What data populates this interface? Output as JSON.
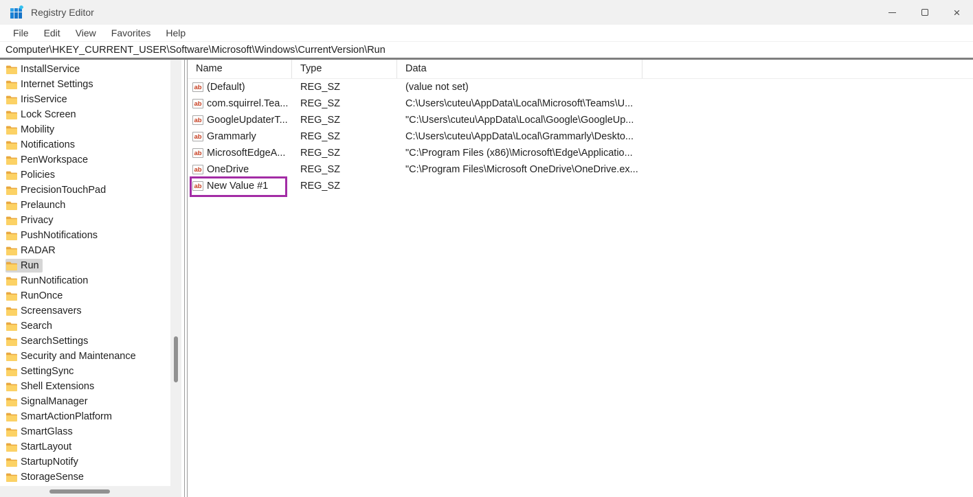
{
  "window": {
    "title": "Registry Editor"
  },
  "titlebar": {
    "close_glyph": "×"
  },
  "menubar": {
    "items": [
      "File",
      "Edit",
      "View",
      "Favorites",
      "Help"
    ]
  },
  "address_bar": {
    "path": "Computer\\HKEY_CURRENT_USER\\Software\\Microsoft\\Windows\\CurrentVersion\\Run"
  },
  "tree": {
    "items": [
      {
        "label": "InstallService",
        "selected": false,
        "expandable": false
      },
      {
        "label": "Internet Settings",
        "selected": false,
        "expandable": false
      },
      {
        "label": "IrisService",
        "selected": false,
        "expandable": false
      },
      {
        "label": "Lock Screen",
        "selected": false,
        "expandable": false
      },
      {
        "label": "Mobility",
        "selected": false,
        "expandable": false
      },
      {
        "label": "Notifications",
        "selected": false,
        "expandable": false
      },
      {
        "label": "PenWorkspace",
        "selected": false,
        "expandable": false
      },
      {
        "label": "Policies",
        "selected": false,
        "expandable": true
      },
      {
        "label": "PrecisionTouchPad",
        "selected": false,
        "expandable": false
      },
      {
        "label": "Prelaunch",
        "selected": false,
        "expandable": true
      },
      {
        "label": "Privacy",
        "selected": false,
        "expandable": true
      },
      {
        "label": "PushNotifications",
        "selected": false,
        "expandable": false
      },
      {
        "label": "RADAR",
        "selected": false,
        "expandable": true
      },
      {
        "label": "Run",
        "selected": true,
        "expandable": false
      },
      {
        "label": "RunNotification",
        "selected": false,
        "expandable": true
      },
      {
        "label": "RunOnce",
        "selected": false,
        "expandable": true
      },
      {
        "label": "Screensavers",
        "selected": false,
        "expandable": false
      },
      {
        "label": "Search",
        "selected": false,
        "expandable": false
      },
      {
        "label": "SearchSettings",
        "selected": false,
        "expandable": false
      },
      {
        "label": "Security and Maintenance",
        "selected": false,
        "expandable": false
      },
      {
        "label": "SettingSync",
        "selected": false,
        "expandable": false
      },
      {
        "label": "Shell Extensions",
        "selected": false,
        "expandable": false
      },
      {
        "label": "SignalManager",
        "selected": false,
        "expandable": false
      },
      {
        "label": "SmartActionPlatform",
        "selected": false,
        "expandable": false
      },
      {
        "label": "SmartGlass",
        "selected": false,
        "expandable": true
      },
      {
        "label": "StartLayout",
        "selected": false,
        "expandable": false
      },
      {
        "label": "StartupNotify",
        "selected": false,
        "expandable": true
      },
      {
        "label": "StorageSense",
        "selected": false,
        "expandable": false
      }
    ]
  },
  "list": {
    "columns": [
      "Name",
      "Type",
      "Data"
    ],
    "rows": [
      {
        "name": "(Default)",
        "type": "REG_SZ",
        "data": "(value not set)",
        "highlighted": false
      },
      {
        "name": "com.squirrel.Tea...",
        "type": "REG_SZ",
        "data": "C:\\Users\\cuteu\\AppData\\Local\\Microsoft\\Teams\\U...",
        "highlighted": false
      },
      {
        "name": "GoogleUpdaterT...",
        "type": "REG_SZ",
        "data": "\"C:\\Users\\cuteu\\AppData\\Local\\Google\\GoogleUp...",
        "highlighted": false
      },
      {
        "name": "Grammarly",
        "type": "REG_SZ",
        "data": "C:\\Users\\cuteu\\AppData\\Local\\Grammarly\\Deskto...",
        "highlighted": false
      },
      {
        "name": "MicrosoftEdgeA...",
        "type": "REG_SZ",
        "data": "\"C:\\Program Files (x86)\\Microsoft\\Edge\\Applicatio...",
        "highlighted": false
      },
      {
        "name": "OneDrive",
        "type": "REG_SZ",
        "data": "\"C:\\Program Files\\Microsoft OneDrive\\OneDrive.ex...",
        "highlighted": false
      },
      {
        "name": "New Value #1",
        "type": "REG_SZ",
        "data": "",
        "highlighted": true
      }
    ],
    "value_icon_label": "ab"
  },
  "annotation": {
    "color": "#a32ca5",
    "target": "New Value #1"
  }
}
